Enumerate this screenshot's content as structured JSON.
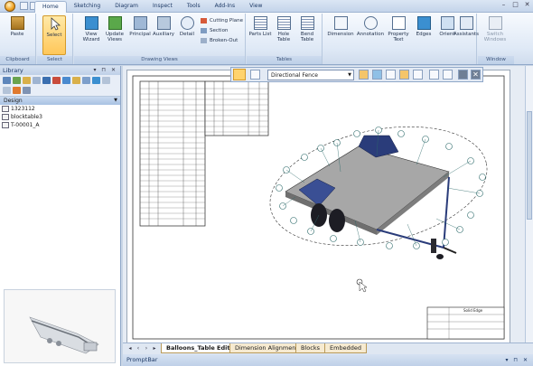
{
  "ribbon_tabs": [
    "Home",
    "Sketching",
    "Diagram",
    "Inspect",
    "Tools",
    "Add-Ins",
    "View"
  ],
  "ribbon": {
    "clipboard": {
      "title": "Clipboard",
      "paste": "Paste"
    },
    "select": {
      "title": "Select",
      "select": "Select"
    },
    "drawing_views": {
      "title": "Drawing Views",
      "view_wizard": "View Wizard",
      "update_views": "Update Views",
      "principal": "Principal",
      "auxiliary": "Auxiliary",
      "detail": "Detail",
      "cutting_plane": "Cutting Plane",
      "section": "Section",
      "broken_out": "Broken-Out"
    },
    "tables": {
      "title": "Tables",
      "parts_list": "Parts List",
      "hole_table": "Hole Table",
      "bend_table": "Bend Table"
    },
    "dimension": "Dimension",
    "annotation": "Annotation",
    "property_text": "Property Text",
    "edges": "Edges",
    "orient": "Orient",
    "assistants": "Assistants",
    "window": {
      "title": "Window",
      "switch_windows": "Switch Windows"
    }
  },
  "library": {
    "title": "Library",
    "folder": "Design",
    "items": [
      "1323112",
      "blocktable3",
      "T-00001_A"
    ]
  },
  "floatbar": {
    "style_select": "Directional Fence"
  },
  "sheet_tabs": [
    "Balloons_Table Edit",
    "Dimension Alignment",
    "Blocks",
    "Embedded"
  ],
  "promptbar": {
    "title": "PromptBar"
  },
  "title_block": {
    "label": "Solid Edge"
  },
  "colors": {
    "accent": "#ffc759",
    "ribbon_bg": "#dfe9f6",
    "tab_active": "#ffffff"
  }
}
